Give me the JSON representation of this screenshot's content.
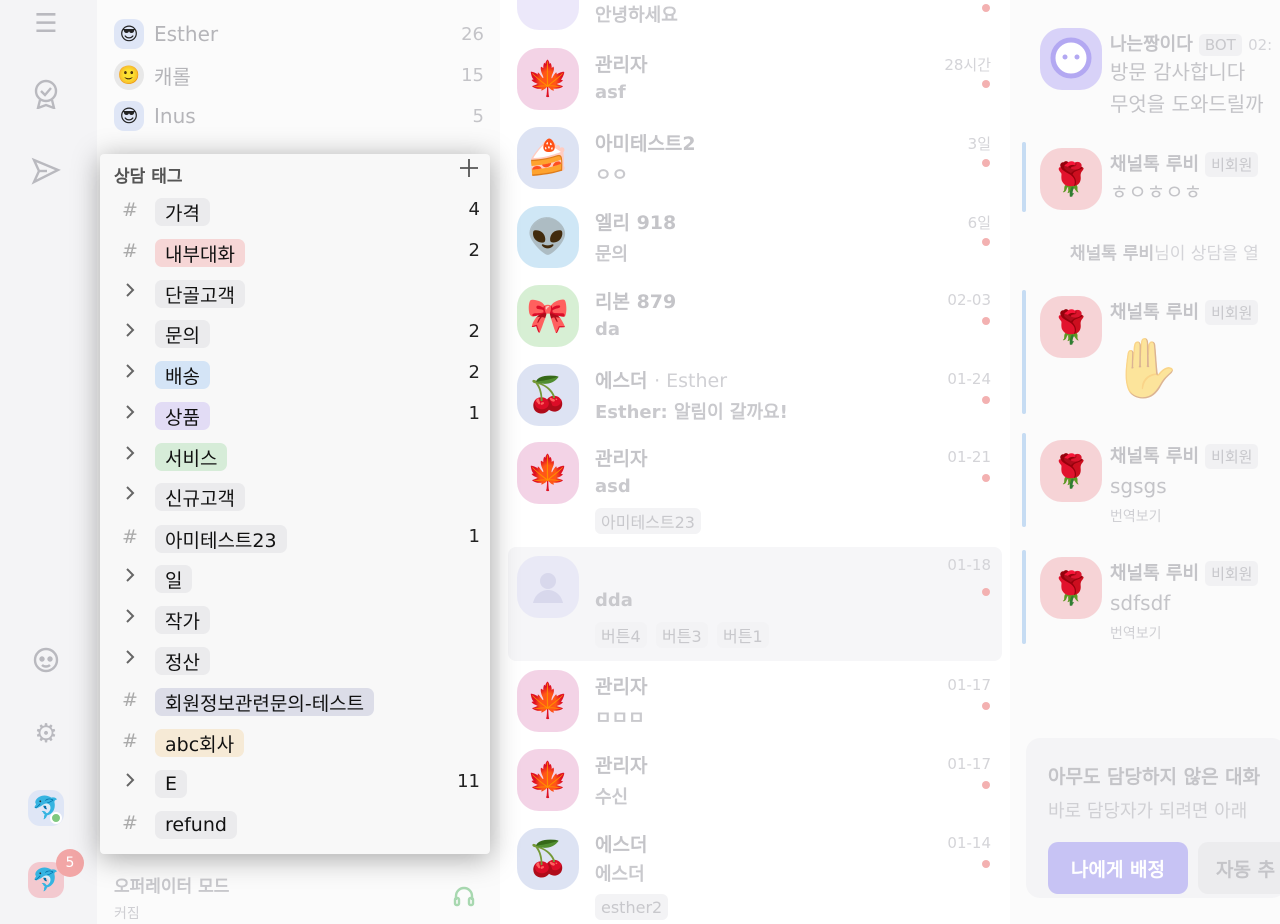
{
  "rail": {
    "badge_count": "5"
  },
  "user_list": [
    {
      "name": "Esther",
      "count": "26",
      "avatar": "😎"
    },
    {
      "name": "캐롤",
      "count": "15",
      "avatar": "🙂"
    },
    {
      "name": "Inus",
      "count": "5",
      "avatar": "😎"
    }
  ],
  "operator": {
    "title": "오퍼레이터 모드",
    "status": "커짐"
  },
  "tag_popup": {
    "title": "상담 태그",
    "add_icon": "plus-icon",
    "tags": [
      {
        "label": "가격",
        "count": "4",
        "type": "leaf",
        "color": "#ebebed"
      },
      {
        "label": "내부대화",
        "count": "2",
        "type": "leaf",
        "color": "#f6d6d6"
      },
      {
        "label": "단골고객",
        "count": "",
        "type": "group",
        "color": "#ebebed"
      },
      {
        "label": "문의",
        "count": "2",
        "type": "group",
        "color": "#ebebed"
      },
      {
        "label": "배송",
        "count": "2",
        "type": "group",
        "color": "#d4e4f6"
      },
      {
        "label": "상품",
        "count": "1",
        "type": "group",
        "color": "#e2dcf5"
      },
      {
        "label": "서비스",
        "count": "",
        "type": "group",
        "color": "#d6ecd8"
      },
      {
        "label": "신규고객",
        "count": "",
        "type": "group",
        "color": "#ebebed"
      },
      {
        "label": "아미테스트23",
        "count": "1",
        "type": "leaf",
        "color": "#ebebed"
      },
      {
        "label": "일",
        "count": "",
        "type": "group",
        "color": "#ebebed"
      },
      {
        "label": "작가",
        "count": "",
        "type": "group",
        "color": "#ebebed"
      },
      {
        "label": "정산",
        "count": "",
        "type": "group",
        "color": "#ebebed"
      },
      {
        "label": "회원정보관련문의-테스트",
        "count": "",
        "type": "leaf",
        "color": "#dcdde8"
      },
      {
        "label": "abc회사",
        "count": "",
        "type": "leaf",
        "color": "#f6ead6"
      },
      {
        "label": "E",
        "count": "11",
        "type": "group",
        "color": "#ebebed"
      },
      {
        "label": "refund",
        "count": "",
        "type": "leaf",
        "color": "#ebebed"
      }
    ]
  },
  "chats": [
    {
      "name": "",
      "sub": "",
      "msg": "안녕하세요",
      "time": "",
      "avatar": "",
      "tags": []
    },
    {
      "name": "관리자",
      "sub": "",
      "msg": "asf",
      "time": "28시간",
      "avatar": "🍁",
      "tags": []
    },
    {
      "name": "아미테스트2",
      "sub": "",
      "msg": "ㅇㅇ",
      "time": "3일",
      "avatar": "🍰",
      "tags": []
    },
    {
      "name": "엘리 918",
      "sub": "",
      "msg": "문의",
      "time": "6일",
      "avatar": "👽",
      "tags": []
    },
    {
      "name": "리본 879",
      "sub": "",
      "msg": "da",
      "time": "02-03",
      "avatar": "🎀",
      "tags": []
    },
    {
      "name": "에스더",
      "sub": "· Esther",
      "msg": "Esther: 알림이 갈까요!",
      "time": "01-24",
      "avatar": "🍒",
      "tags": []
    },
    {
      "name": "관리자",
      "sub": "",
      "msg": "asd",
      "time": "01-21",
      "avatar": "🍁",
      "tags": [
        "아미테스트23"
      ]
    },
    {
      "name": "",
      "sub": "",
      "msg": "dda",
      "time": "01-18",
      "avatar": "",
      "tags": [
        "버튼4",
        "버튼3",
        "버튼1"
      ]
    },
    {
      "name": "관리자",
      "sub": "",
      "msg": "ㅁㅁㅁ",
      "time": "01-17",
      "avatar": "🍁",
      "tags": []
    },
    {
      "name": "관리자",
      "sub": "",
      "msg": "수신",
      "time": "01-17",
      "avatar": "🍁",
      "tags": []
    },
    {
      "name": "에스더",
      "sub": "",
      "msg": "에스더",
      "time": "01-14",
      "avatar": "🍒",
      "tags": [
        "esther2"
      ]
    }
  ],
  "thread": {
    "bot_name": "나는짱이다",
    "bot_role": "BOT",
    "bot_time": "02:",
    "bot_line1": "방문 감사합니다",
    "bot_line2": "무엇을 도와드릴까",
    "agent_name": "채널톡 루비",
    "agent_role": "비회원",
    "msg1": "ㅎㅇㅎㅇㅎ",
    "system_name": "채널톡 루비",
    "system_text": "님이 상담을 열",
    "msg2_emoji": "✋",
    "msg3": "sgsgs",
    "msg4": "sdfsdf",
    "translate": "번역보기",
    "assign_title": "아무도 담당하지 않은 대화",
    "assign_sub": "바로 담당자가 되려면 아래",
    "assign_btn": "나에게 배정",
    "auto_btn": "자동 추"
  }
}
